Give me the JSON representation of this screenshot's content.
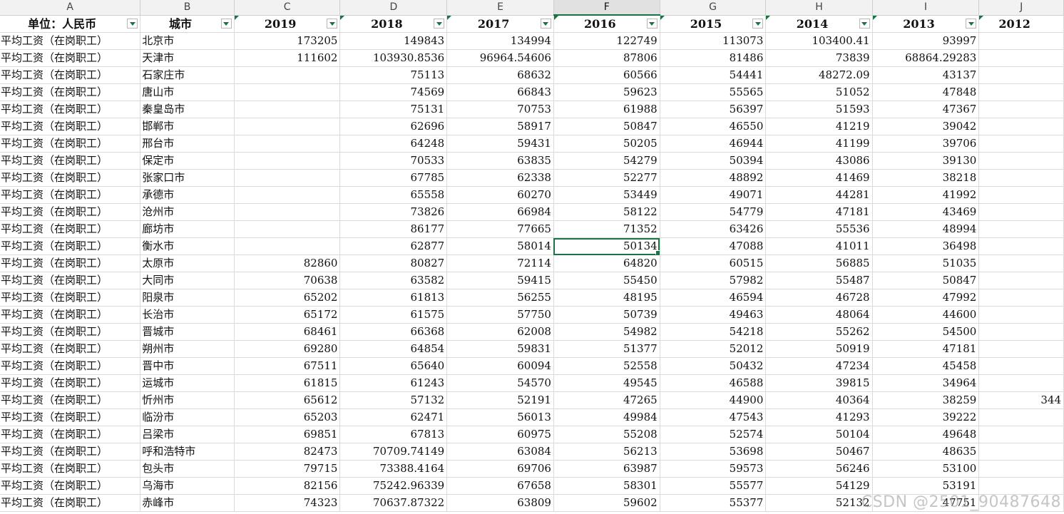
{
  "colors": {
    "accent": "#1e7145",
    "gridline": "#dadada",
    "header_bg": "#f2f2f2"
  },
  "selected_column": "F",
  "column_letters": [
    "A",
    "B",
    "C",
    "D",
    "E",
    "F",
    "G",
    "H",
    "I",
    "J"
  ],
  "headers": [
    "单位：人民币",
    "城市",
    "2019",
    "2018",
    "2017",
    "2016",
    "2015",
    "2014",
    "2013",
    "2012"
  ],
  "rows": [
    [
      "平均工资（在岗职工）",
      "北京市",
      "173205",
      "149843",
      "134994",
      "122749",
      "113073",
      "103400.41",
      "93997",
      ""
    ],
    [
      "平均工资（在岗职工）",
      "天津市",
      "111602",
      "103930.8536",
      "96964.54606",
      "87806",
      "81486",
      "73839",
      "68864.29283",
      ""
    ],
    [
      "平均工资（在岗职工）",
      "石家庄市",
      "",
      "75113",
      "68632",
      "60566",
      "54441",
      "48272.09",
      "43137",
      ""
    ],
    [
      "平均工资（在岗职工）",
      "唐山市",
      "",
      "74569",
      "66843",
      "59623",
      "55565",
      "51052",
      "47848",
      ""
    ],
    [
      "平均工资（在岗职工）",
      "秦皇岛市",
      "",
      "75131",
      "70753",
      "61988",
      "56397",
      "51593",
      "47367",
      ""
    ],
    [
      "平均工资（在岗职工）",
      "邯郸市",
      "",
      "62696",
      "58917",
      "50847",
      "46550",
      "41219",
      "39042",
      ""
    ],
    [
      "平均工资（在岗职工）",
      "邢台市",
      "",
      "64248",
      "59431",
      "50205",
      "46944",
      "41199",
      "39706",
      ""
    ],
    [
      "平均工资（在岗职工）",
      "保定市",
      "",
      "70533",
      "63835",
      "54279",
      "50394",
      "43086",
      "39130",
      ""
    ],
    [
      "平均工资（在岗职工）",
      "张家口市",
      "",
      "67785",
      "62338",
      "52277",
      "48892",
      "41469",
      "38218",
      ""
    ],
    [
      "平均工资（在岗职工）",
      "承德市",
      "",
      "65558",
      "60270",
      "53449",
      "49071",
      "44281",
      "41992",
      ""
    ],
    [
      "平均工资（在岗职工）",
      "沧州市",
      "",
      "73826",
      "66984",
      "58122",
      "54779",
      "47181",
      "43469",
      ""
    ],
    [
      "平均工资（在岗职工）",
      "廊坊市",
      "",
      "86177",
      "77665",
      "71352",
      "63426",
      "55536",
      "48994",
      ""
    ],
    [
      "平均工资（在岗职工）",
      "衡水市",
      "",
      "62877",
      "58014",
      "50134",
      "47088",
      "41011",
      "36498",
      ""
    ],
    [
      "平均工资（在岗职工）",
      "太原市",
      "82860",
      "80827",
      "72114",
      "64820",
      "60515",
      "56885",
      "51035",
      ""
    ],
    [
      "平均工资（在岗职工）",
      "大同市",
      "70638",
      "63582",
      "59415",
      "55450",
      "57982",
      "55487",
      "50847",
      ""
    ],
    [
      "平均工资（在岗职工）",
      "阳泉市",
      "65202",
      "61813",
      "56255",
      "48195",
      "46594",
      "46728",
      "47992",
      ""
    ],
    [
      "平均工资（在岗职工）",
      "长治市",
      "65172",
      "61575",
      "57750",
      "50739",
      "49463",
      "48064",
      "44600",
      ""
    ],
    [
      "平均工资（在岗职工）",
      "晋城市",
      "68461",
      "66368",
      "62008",
      "54982",
      "54218",
      "55262",
      "54500",
      ""
    ],
    [
      "平均工资（在岗职工）",
      "朔州市",
      "69280",
      "64854",
      "59831",
      "51377",
      "52012",
      "50919",
      "47181",
      ""
    ],
    [
      "平均工资（在岗职工）",
      "晋中市",
      "67511",
      "65640",
      "60094",
      "52558",
      "50432",
      "47234",
      "45458",
      ""
    ],
    [
      "平均工资（在岗职工）",
      "运城市",
      "61815",
      "61243",
      "54570",
      "49545",
      "46588",
      "39815",
      "34964",
      ""
    ],
    [
      "平均工资（在岗职工）",
      "忻州市",
      "65612",
      "57132",
      "52191",
      "47265",
      "44900",
      "40364",
      "38259",
      "344"
    ],
    [
      "平均工资（在岗职工）",
      "临汾市",
      "65203",
      "62471",
      "56013",
      "49984",
      "47543",
      "41293",
      "39222",
      ""
    ],
    [
      "平均工资（在岗职工）",
      "吕梁市",
      "69851",
      "67813",
      "60975",
      "55208",
      "52574",
      "50104",
      "49648",
      ""
    ],
    [
      "平均工资（在岗职工）",
      "呼和浩特市",
      "82473",
      "70709.74149",
      "63084",
      "56213",
      "53698",
      "50467",
      "48635",
      ""
    ],
    [
      "平均工资（在岗职工）",
      "包头市",
      "79715",
      "73388.4164",
      "69706",
      "63987",
      "59573",
      "56246",
      "53100",
      ""
    ],
    [
      "平均工资（在岗职工）",
      "乌海市",
      "82156",
      "75242.96339",
      "67658",
      "58301",
      "55577",
      "54129",
      "53191",
      ""
    ],
    [
      "平均工资（在岗职工）",
      "赤峰市",
      "74323",
      "70637.87322",
      "63809",
      "59602",
      "55377",
      "52132",
      "47751",
      ""
    ]
  ],
  "watermark": "CSDN @2501_90487648"
}
